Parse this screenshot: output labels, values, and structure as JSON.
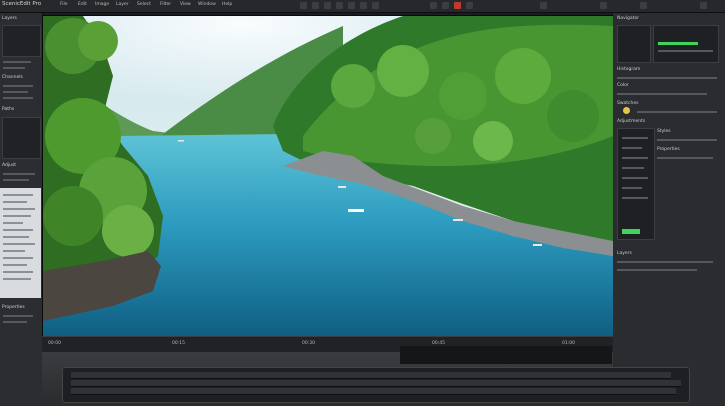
{
  "app": {
    "title": "ScenicEdit Pro",
    "menu_items": [
      "File",
      "Edit",
      "Image",
      "Layer",
      "Select",
      "Filter",
      "View",
      "Window",
      "Help"
    ]
  },
  "left_panel": {
    "headers": [
      "Layers",
      "Channels",
      "Paths",
      "Adjust",
      "Properties"
    ]
  },
  "right_panel": {
    "labels": [
      "Navigator",
      "Histogram",
      "Color",
      "Swatches",
      "Adjustments",
      "Styles",
      "Properties",
      "Layers"
    ]
  },
  "timeline": {
    "labels": [
      "00:00",
      "00:15",
      "00:30",
      "00:45",
      "01:00"
    ]
  },
  "colors": {
    "accent": "#4fa3d1",
    "green_status": "#3fd45c"
  }
}
